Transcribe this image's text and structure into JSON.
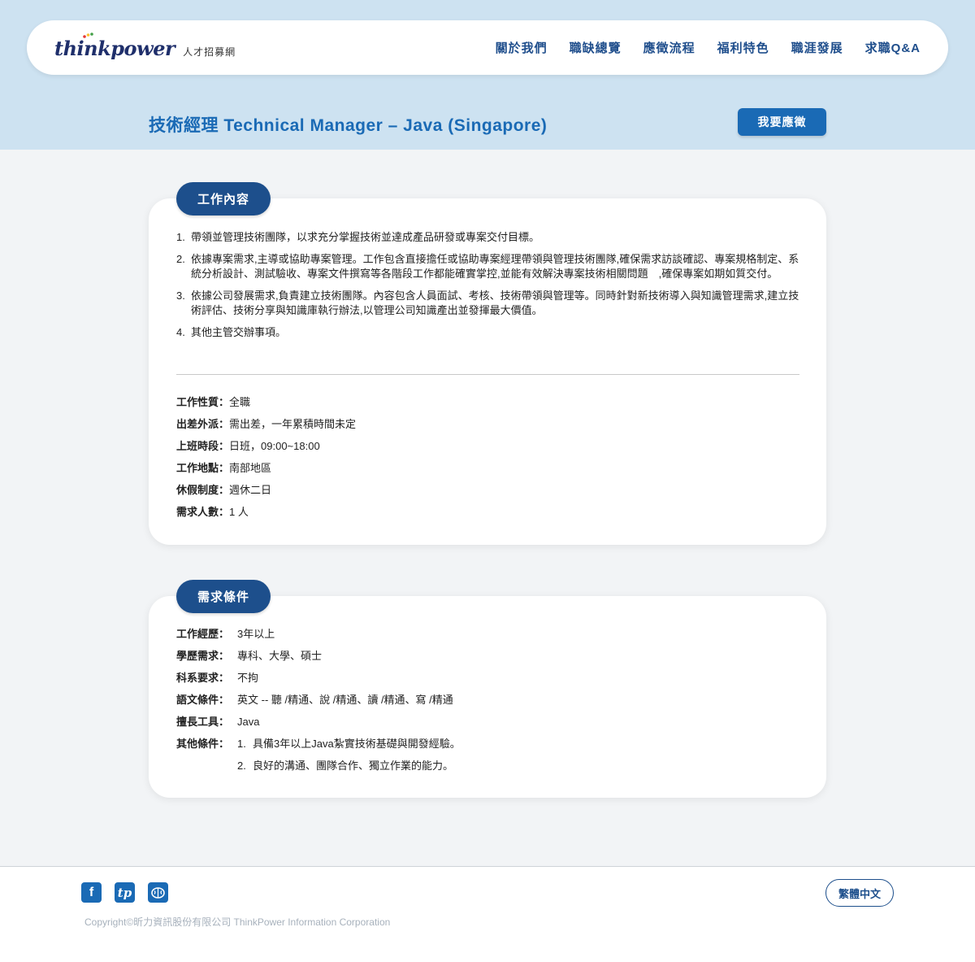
{
  "header": {
    "logo_text_a": "thin",
    "logo_text_b": "k",
    "logo_text_c": "power",
    "logo_sub": "人才招募網",
    "nav": [
      "關於我們",
      "職缺總覽",
      "應徵流程",
      "福利特色",
      "職涯發展",
      "求職Q&A"
    ]
  },
  "job": {
    "title": "技術經理 Technical Manager – Java (Singapore)",
    "apply_label": "我要應徵"
  },
  "section_content": {
    "tab_label": "工作內容",
    "duties": [
      {
        "num": "1.",
        "text": "帶領並管理技術團隊，以求充分掌握技術並達成產品研發或專案交付目標。"
      },
      {
        "num": "2.",
        "text": "依據專案需求,主導或協助專案管理。工作包含直接擔任或協助專案經理帶領與管理技術團隊,確保需求訪談確認、專案規格制定、系統分析設計、測試驗收、專案文件撰寫等各階段工作都能確實掌控,並能有效解決專案技術相關問題　,確保專案如期如質交付。"
      },
      {
        "num": "3.",
        "text": "依據公司發展需求,負責建立技術團隊。內容包含人員面試、考核、技術帶領與管理等。同時針對新技術導入與知識管理需求,建立技術評估、技術分享與知識庫執行辦法,以管理公司知識產出並發揮最大價值。"
      },
      {
        "num": "4.",
        "text": "其他主管交辦事項。"
      }
    ],
    "info": [
      {
        "key": "工作性質：",
        "value": "全職"
      },
      {
        "key": "出差外派：",
        "value": "需出差，一年累積時間未定"
      },
      {
        "key": "上班時段：",
        "value": "日班，09:00~18:00"
      },
      {
        "key": "工作地點：",
        "value": "南部地區"
      },
      {
        "key": "休假制度：",
        "value": "週休二日"
      },
      {
        "key": "需求人數：",
        "value": "1 人"
      }
    ]
  },
  "section_requirements": {
    "tab_label": "需求條件",
    "rows": [
      {
        "key": "工作經歷：",
        "value": "3年以上"
      },
      {
        "key": "學歷需求：",
        "value": "專科、大學、碩士"
      },
      {
        "key": "科系要求：",
        "value": "不拘"
      },
      {
        "key": "語文條件：",
        "value": "英文 -- 聽 /精通、說 /精通、讀 /精通、寫 /精通"
      },
      {
        "key": "擅長工具：",
        "value": "Java"
      }
    ],
    "other_key": "其他條件：",
    "other_items": [
      {
        "num": "1.",
        "text": "具備3年以上Java紮實技術基礎與開發經驗。"
      },
      {
        "num": "2.",
        "text": "良好的溝通、團隊合作、獨立作業的能力。"
      }
    ]
  },
  "footer": {
    "social": [
      {
        "icon": "facebook-icon",
        "glyph": "f"
      },
      {
        "icon": "thinkpower-icon",
        "glyph": "tp"
      },
      {
        "icon": "brain-icon",
        "glyph": ""
      }
    ],
    "copyright": "Copyright©昕力資訊股份有限公司 ThinkPower Information Corporation",
    "lang_label": "繁體中文"
  },
  "colors": {
    "hero_bg": "#cde2f1",
    "brand_blue": "#1a6ab5",
    "tab_navy": "#1d4f8c"
  }
}
